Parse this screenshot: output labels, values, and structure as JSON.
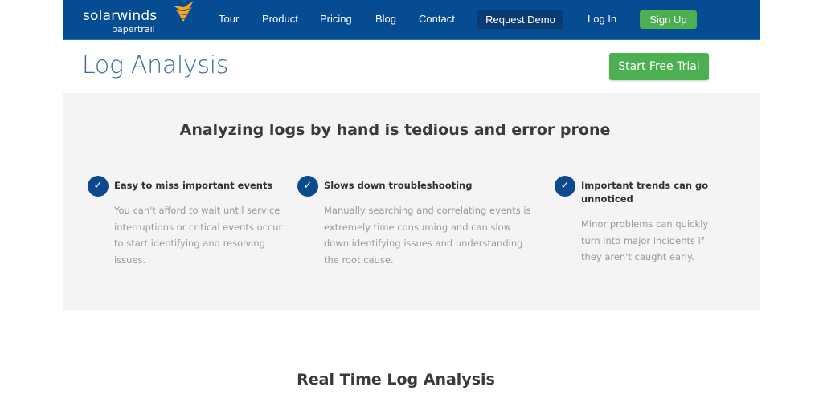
{
  "brand": {
    "name": "solarwinds",
    "product": "papertrail",
    "colors": {
      "nav_bg": "#054c93",
      "accent_green": "#4caf50",
      "title_blue": "#3d6a9c",
      "check_blue": "#0d4a8c",
      "logo_orange": "#f5a623"
    }
  },
  "nav": {
    "links": [
      {
        "label": "Tour",
        "icon": null
      },
      {
        "label": "Product",
        "icon": null
      },
      {
        "label": "Pricing",
        "icon": null
      },
      {
        "label": "Blog",
        "icon": null
      },
      {
        "label": "Contact",
        "icon": null
      }
    ],
    "request_demo": "Request Demo",
    "login": "Log In",
    "signup": "Sign Up"
  },
  "header": {
    "title": "Log Analysis",
    "cta": "Start Free Trial"
  },
  "problems": {
    "heading": "Analyzing logs by hand is tedious and error prone",
    "items": [
      {
        "icon": "check-circle-icon",
        "title": "Easy to miss important events",
        "body": "You can't afford to wait until service interruptions or critical events occur to start identifying and resolving issues."
      },
      {
        "icon": "check-circle-icon",
        "title": "Slows down troubleshooting",
        "body": "Manually searching and correlating events is extremely time consuming and can slow down identifying issues and understanding the root cause."
      },
      {
        "icon": "check-circle-icon",
        "title": "Important trends can go unnoticed",
        "body": "Minor problems can quickly turn into major incidents if they aren't caught early."
      }
    ]
  },
  "next_section": {
    "title": "Real Time Log Analysis"
  }
}
